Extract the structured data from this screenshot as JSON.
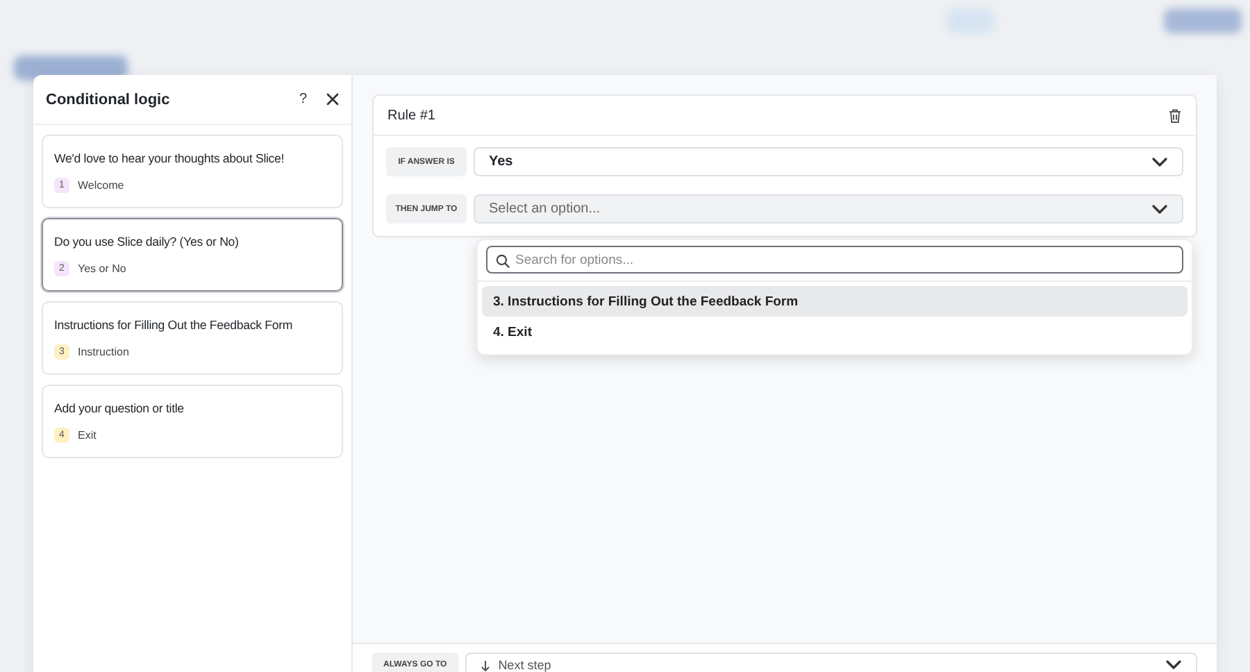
{
  "dialog": {
    "title": "Conditional logic",
    "help_label": "?"
  },
  "steps": [
    {
      "title": "We'd love to hear your thoughts about Slice!",
      "number": "1",
      "type": "Welcome",
      "color": "#f5e4fb",
      "selected": false
    },
    {
      "title": "Do you use Slice daily? (Yes or No)",
      "number": "2",
      "type": "Yes or No",
      "color": "#f5e4fb",
      "selected": true
    },
    {
      "title": "Instructions for Filling Out the Feedback Form",
      "number": "3",
      "type": "Instruction",
      "color": "#fdf1c4",
      "selected": false
    },
    {
      "title": "Add your question or title",
      "number": "4",
      "type": "Exit",
      "color": "#fdf1c4",
      "selected": false
    }
  ],
  "rule": {
    "title": "Rule #1",
    "if_label": "IF ANSWER IS",
    "answer": "Yes",
    "jump_label": "THEN JUMP TO",
    "jump_placeholder": "Select an option..."
  },
  "dropdown": {
    "search_placeholder": "Search for options...",
    "options": [
      {
        "label": "3. Instructions for Filling Out the Feedback Form",
        "selected": true
      },
      {
        "label": "4. Exit",
        "selected": false
      }
    ]
  },
  "footer": {
    "label": "ALWAYS GO TO",
    "value": "Next step"
  }
}
